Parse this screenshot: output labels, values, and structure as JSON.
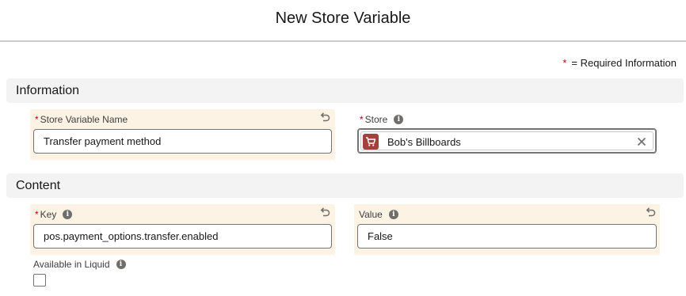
{
  "modal": {
    "title": "New Store Variable"
  },
  "legend": {
    "star": "*",
    "text": "= Required Information"
  },
  "sections": {
    "information": {
      "title": "Information"
    },
    "content": {
      "title": "Content"
    }
  },
  "fields": {
    "store_variable_name": {
      "label": "Store Variable Name",
      "required_mark": "*",
      "value": "Transfer payment method"
    },
    "store": {
      "label": "Store",
      "required_mark": "*",
      "value": "Bob's Billboards",
      "icon": "shopping-cart-icon"
    },
    "key": {
      "label": "Key",
      "required_mark": "*",
      "value": "pos.payment_options.transfer.enabled"
    },
    "value": {
      "label": "Value",
      "value": "False"
    },
    "available_in_liquid": {
      "label": "Available in Liquid",
      "checked": false
    }
  },
  "colors": {
    "edited_field_bg": "#fdf3e5",
    "required_star": "#ba0517",
    "store_icon_bg": "#a2403b",
    "section_bg": "#f3f3f3"
  }
}
